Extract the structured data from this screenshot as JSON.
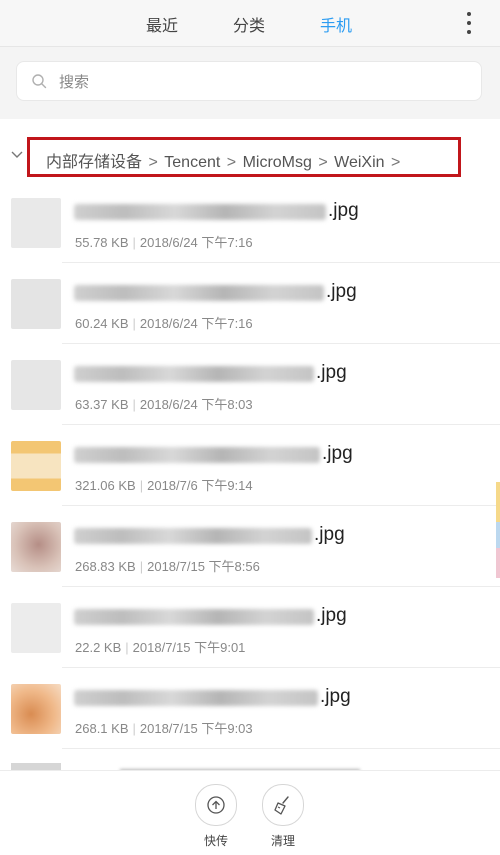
{
  "tabs": [
    {
      "label": "最近",
      "active": false
    },
    {
      "label": "分类",
      "active": false
    },
    {
      "label": "手机",
      "active": true
    }
  ],
  "search": {
    "placeholder": "搜索"
  },
  "breadcrumb": {
    "items": [
      "内部存储设备",
      "Tencent",
      "MicroMsg",
      "WeiXin"
    ],
    "separator": ">"
  },
  "files": [
    {
      "ext": ".jpg",
      "size": "55.78 KB",
      "date": "2018/6/24 下午7:16",
      "thumb": "#e9e9e9"
    },
    {
      "ext": ".jpg",
      "size": "60.24 KB",
      "date": "2018/6/24 下午7:16",
      "thumb": "#e4e4e4"
    },
    {
      "ext": ".jpg",
      "size": "63.37 KB",
      "date": "2018/6/24 下午8:03",
      "thumb": "#e6e6e6"
    },
    {
      "ext": ".jpg",
      "size": "321.06 KB",
      "date": "2018/7/6 下午9:14",
      "thumb": "#f0c27a"
    },
    {
      "ext": ".jpg",
      "size": "268.83 KB",
      "date": "2018/7/15 下午8:56",
      "thumb": "#c9a49a"
    },
    {
      "ext": ".jpg",
      "size": "22.2 KB",
      "date": "2018/7/15 下午9:01",
      "thumb": "#e7e7e7"
    },
    {
      "ext": ".jpg",
      "size": "268.1 KB",
      "date": "2018/7/15 下午9:03",
      "thumb": "#e9a86e"
    }
  ],
  "actions": [
    {
      "label": "快传",
      "icon": "upload-circle-icon"
    },
    {
      "label": "清理",
      "icon": "broom-icon"
    }
  ],
  "colors": {
    "accent": "#2b9cf2",
    "highlight_box": "#c1161b"
  }
}
